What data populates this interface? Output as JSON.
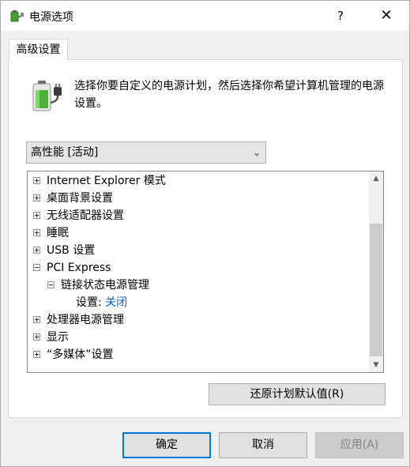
{
  "window": {
    "title": "电源选项",
    "help": "?",
    "close": "✕"
  },
  "tab": {
    "label": "高级设置"
  },
  "description": "选择你要自定义的电源计划，然后选择你希望计算机管理的电源设置。",
  "plan_select": {
    "value": "高性能 [活动]"
  },
  "tree": {
    "items": [
      {
        "label": "Internet Explorer 模式",
        "expanded": false
      },
      {
        "label": "桌面背景设置",
        "expanded": false
      },
      {
        "label": "无线适配器设置",
        "expanded": false
      },
      {
        "label": "睡眠",
        "expanded": false
      },
      {
        "label": "USB 设置",
        "expanded": false
      },
      {
        "label": "PCI Express",
        "expanded": true
      },
      {
        "label": "链接状态电源管理",
        "expanded": true
      },
      {
        "label": "处理器电源管理",
        "expanded": false
      },
      {
        "label": "显示",
        "expanded": false
      },
      {
        "label": "“多媒体”设置",
        "expanded": false
      }
    ],
    "setting": {
      "label": "设置:",
      "value": "关闭"
    }
  },
  "buttons": {
    "restore": "还原计划默认值(R)",
    "ok": "确定",
    "cancel": "取消",
    "apply": "应用(A)"
  },
  "colors": {
    "accent": "#0078d7",
    "link": "#0066cc"
  }
}
